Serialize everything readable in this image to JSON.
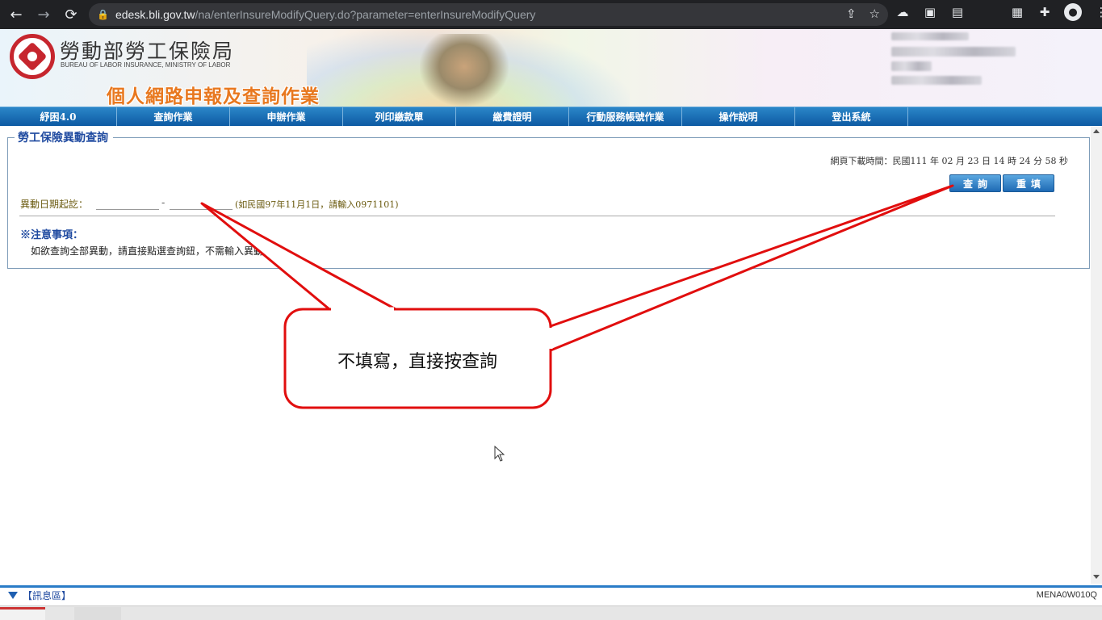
{
  "browser": {
    "url_host": "edesk.bli.gov.tw",
    "url_path": "/na/enterInsureModifyQuery.do?parameter=enterInsureModifyQuery"
  },
  "banner": {
    "org_name": "勞動部勞工保險局",
    "org_name_en": "BUREAU OF LABOR INSURANCE, MINISTRY OF LABOR",
    "system_title": "個人網路申報及查詢作業"
  },
  "menu": {
    "items": [
      "紓困4.0",
      "查詢作業",
      "申辦作業",
      "列印繳款單",
      "繳費證明",
      "行動服務帳號作業",
      "操作說明",
      "登出系統"
    ]
  },
  "form": {
    "legend": "勞工保險異動查詢",
    "download_time": "網頁下載時間：民國111 年 02 月 23 日 14 時 24 分 58 秒",
    "query_button": "查詢",
    "reset_button": "重填",
    "date_label": "異動日期起訖：",
    "date_start_value": "",
    "date_end_value": "",
    "date_dash": "-",
    "date_hint": "(如民國97年11月1日，請輸入0971101)",
    "note_title": "※注意事項：",
    "note_text": "如欲查詢全部異動，請直接點選查詢鈕，不需輸入異動日期。"
  },
  "callout": {
    "text": "不填寫，直接按查詢",
    "color": "#e10e0e"
  },
  "statusbar": {
    "message_toggle": "【訊息區】",
    "page_code": "MENA0W010Q"
  },
  "colors": {
    "menu_blue": "#0d5aa3",
    "legend_blue": "#1f4aa0",
    "logo_red": "#c6262e",
    "title_orange": "#e8781f"
  }
}
